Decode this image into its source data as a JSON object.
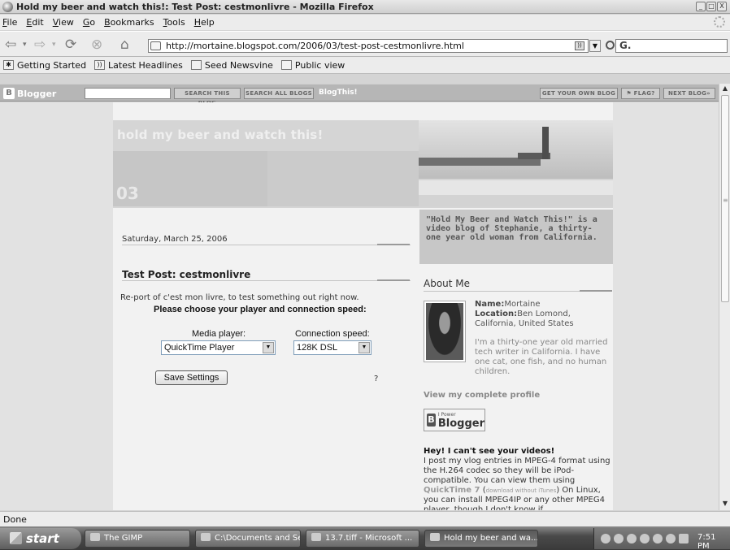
{
  "window": {
    "title": "Hold my beer and watch this!: Test Post: cestmonlivre - Mozilla Firefox",
    "controls": [
      "_",
      "□",
      "X"
    ]
  },
  "menu": [
    "File",
    "Edit",
    "View",
    "Go",
    "Bookmarks",
    "Tools",
    "Help"
  ],
  "nav": {
    "url": "http://mortaine.blogspot.com/2006/03/test-post-cestmonlivre.html",
    "go_label": "Go",
    "search_value": "G."
  },
  "bookmarks": [
    "Getting Started",
    "Latest Headlines",
    "Seed Newsvine",
    "Public view"
  ],
  "blogger_bar": {
    "logo": "Blogger",
    "search_this": "SEARCH THIS BLOG",
    "search_all": "SEARCH ALL BLOGS",
    "blogthis": "BlogThis!",
    "get_own": "GET YOUR OWN BLOG",
    "flag": "⚑ FLAG?",
    "next": "NEXT BLOG»"
  },
  "blog": {
    "header_title": "hold my beer and watch this!",
    "header_num": "03",
    "date": "Saturday, March 25, 2006",
    "post_title": "Test Post: cestmonlivre",
    "post_body": "Re-port of c'est mon livre, to test something out right now.",
    "choose_text": "Please choose your player and connection speed:",
    "media_label": "Media player:",
    "media_value": "QuickTime Player",
    "speed_label": "Connection speed:",
    "speed_value": "128K DSL",
    "save_label": "Save Settings",
    "help_mark": "?"
  },
  "sidebar": {
    "description": "\"Hold My Beer and Watch This!\" is a video blog of Stephanie, a thirty-one year old woman from California.",
    "about_title": "About Me",
    "name_label": "Name:",
    "name_value": "Mortaine",
    "location_label": "Location:",
    "location_value": "Ben Lomond, California, United States",
    "bio": "I'm a thirty-one year old married tech writer in California. I have one cat, one fish, and no human children.",
    "view_profile": "View my complete profile",
    "powered_small": "I Power",
    "powered_big": "Blogger",
    "hey_title": "Hey! I can't see your videos!",
    "hey_text_1": "I post my vlog entries in MPEG-4 format using the H.264 codec so they will be iPod-compatible. You can view them using ",
    "hey_link": "QuickTime 7",
    "hey_text_2": " (",
    "hey_tiny": "download without iTunes",
    "hey_text_3": ") On Linux, you can install MPEG4IP or any other MPEG4 player, though I don't know if"
  },
  "status": "Done",
  "taskbar": {
    "start": "start",
    "tasks": [
      "The GIMP",
      "C:\\Documents and Se...",
      "13.7.tiff - Microsoft ...",
      "Hold my beer and wa..."
    ],
    "clock": "7:51 PM"
  }
}
